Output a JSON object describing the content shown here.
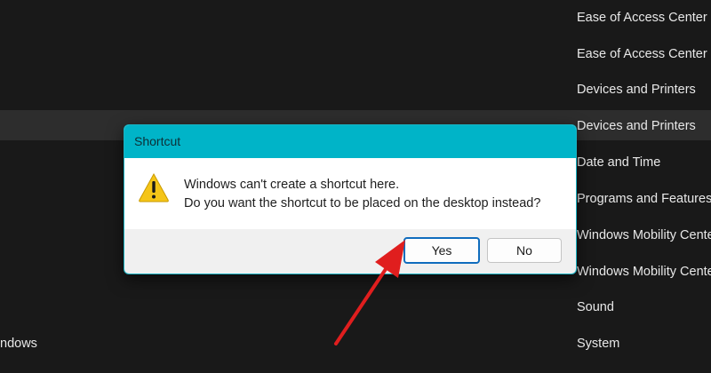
{
  "background_list": {
    "items": [
      "Ease of Access Center",
      "Ease of Access Center",
      "Devices and Printers",
      "Devices and Printers",
      "Date and Time",
      "Programs and Features",
      "Windows Mobility Cente",
      "Windows Mobility Cente",
      "Sound",
      "System"
    ],
    "left_text": "ndows"
  },
  "dialog": {
    "title": "Shortcut",
    "message_line1": "Windows can't create a shortcut here.",
    "message_line2": "Do you want the shortcut to be placed on the desktop instead?",
    "icon": "warning-icon",
    "yes_label": "Yes",
    "no_label": "No"
  },
  "annotation": {
    "icon": "red-arrow-pointer",
    "color": "#e01e1e"
  },
  "colors": {
    "titlebar": "#00b4c8",
    "accent": "#0f6cbd",
    "background": "#191919"
  }
}
